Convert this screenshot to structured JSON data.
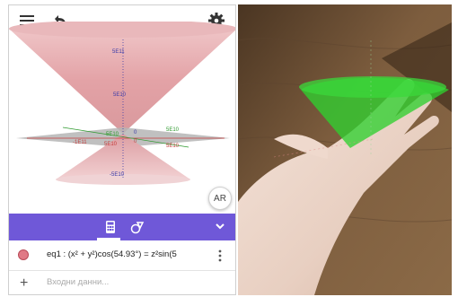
{
  "toolbar": {
    "ar_label": "AR"
  },
  "graph": {
    "labels": {
      "top_5e11": "5E11",
      "upper_5e10": "5E10",
      "right_green_5e10": "5E10",
      "left_neg_1e11": "-1E11",
      "center_green_5e10": "5E10",
      "center_red_5e10": "5E10",
      "center_zero_a": "0",
      "center_zero_b": "0",
      "right_red_5e10": "5E10",
      "lower_neg_5e10": "-5E10"
    },
    "colors": {
      "cone": "#e8a9ad",
      "plane": "#b7b7b7",
      "axis_green": "#2e9a2e",
      "axis_red": "#c43a3a",
      "axis_blue": "#3a3aa8"
    }
  },
  "algebra": {
    "equation": "eq1 : (x² + y²)cos(54.93°) = z²sin(5",
    "input_placeholder": "Входни данни...",
    "dot_color": "#e07a86"
  },
  "theme": {
    "toolbar_color": "#6f58d8"
  }
}
